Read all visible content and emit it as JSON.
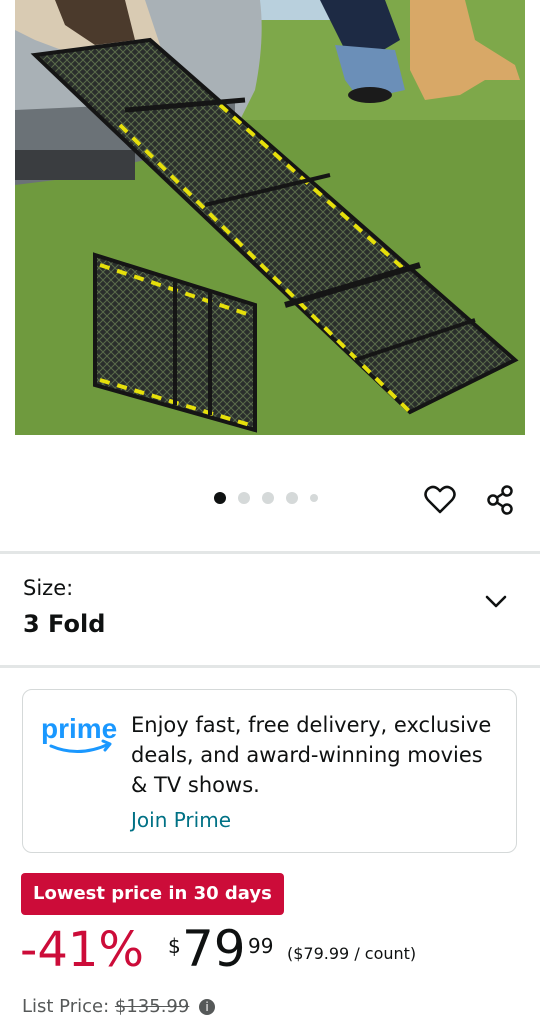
{
  "gallery": {
    "image_alt": "Folding dog ramp leading into car trunk",
    "dot_count": 5,
    "active_index": 0
  },
  "actions": {
    "favorite_icon": "heart-icon",
    "share_icon": "share-icon"
  },
  "size": {
    "label": "Size:",
    "value": "3 Fold",
    "toggle_icon": "chevron-down-icon"
  },
  "prime": {
    "logo_text": "prime",
    "description": "Enjoy fast, free delivery, exclusive deals, and award-winning movies & TV shows.",
    "join_label": "Join Prime"
  },
  "deal": {
    "badge": "Lowest price in 30 days",
    "discount": "-41%",
    "currency": "$",
    "price_whole": "79",
    "price_fraction": "99",
    "unit_price": "($79.99 / count)",
    "list_price_label": "List Price:",
    "list_price_value": "$135.99"
  },
  "colors": {
    "deal_red": "#cc0c39",
    "prime_blue": "#1a98ff",
    "link_teal": "#007185"
  }
}
